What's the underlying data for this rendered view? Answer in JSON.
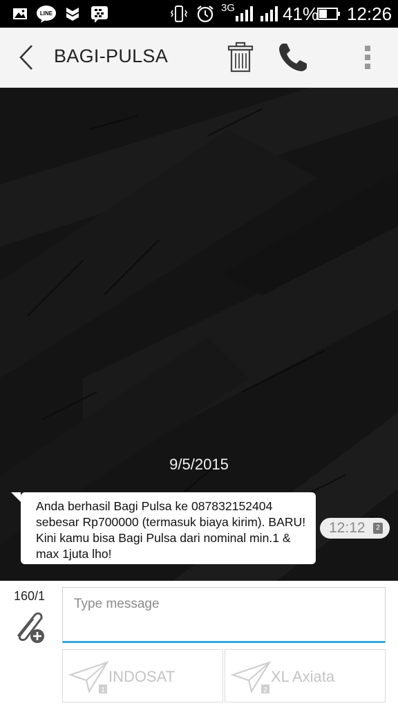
{
  "status_bar": {
    "network_label": "3G",
    "battery": "41%",
    "time": "12:26"
  },
  "header": {
    "title": "BAGI-PULSA"
  },
  "conversation": {
    "date": "9/5/2015",
    "message": {
      "text": "Anda berhasil Bagi Pulsa ke 087832152404 sebesar Rp700000 (termasuk biaya kirim). BARU! Kini kamu bisa Bagi Pulsa dari nominal min.1 & max 1juta lho!",
      "time": "12:12",
      "sim_badge": "2"
    }
  },
  "compose": {
    "counter": "160/1",
    "placeholder": "Type message",
    "send_buttons": [
      {
        "label": "INDOSAT",
        "sim": "1"
      },
      {
        "label": "XL Axiata",
        "sim": "2"
      }
    ]
  },
  "colors": {
    "accent": "#35a7df",
    "background": "#161616",
    "appbar": "#f4f4f4"
  }
}
